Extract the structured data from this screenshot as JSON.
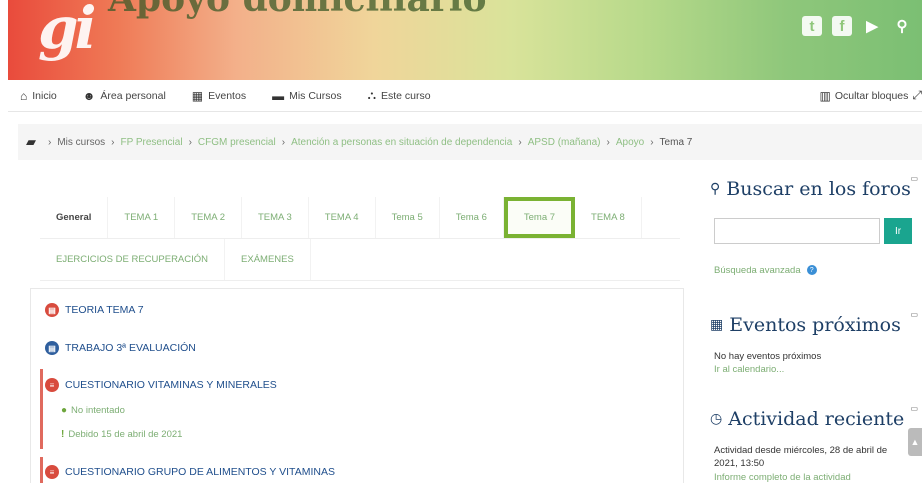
{
  "banner": {
    "logo": "gi",
    "title": "Apoyo domiciliario",
    "social": [
      {
        "icon": "twitter-icon",
        "glyph": "t"
      },
      {
        "icon": "facebook-icon",
        "glyph": "f"
      },
      {
        "icon": "youtube-icon",
        "glyph": "▶"
      },
      {
        "icon": "search-icon",
        "glyph": "⚲"
      }
    ]
  },
  "nav": {
    "items": [
      {
        "label": "Inicio",
        "icon": "home-icon",
        "glyph": "⌂"
      },
      {
        "label": "Área personal",
        "icon": "dashboard-icon",
        "glyph": "☻"
      },
      {
        "label": "Eventos",
        "icon": "calendar-icon",
        "glyph": "▦"
      },
      {
        "label": "Mis Cursos",
        "icon": "courses-icon",
        "glyph": "▬"
      },
      {
        "label": "Este curso",
        "icon": "sitemap-icon",
        "glyph": "⛬"
      }
    ],
    "hide_blocks": "Ocultar bloques"
  },
  "breadcrumb": [
    "Mis cursos",
    "FP Presencial",
    "CFGM presencial",
    "Atención a personas en situación de dependencia",
    "APSD (mañana)",
    "Apoyo",
    "Tema 7"
  ],
  "tabs": {
    "row1": [
      "General",
      "TEMA 1",
      "TEMA 2",
      "TEMA 3",
      "TEMA 4",
      "Tema 5",
      "Tema 6",
      "Tema 7",
      "TEMA 8"
    ],
    "row2": [
      "EJERCICIOS DE RECUPERACIÓN",
      "EXÁMENES"
    ],
    "active": "Tema 7"
  },
  "activities": [
    {
      "title": "TEORIA TEMA 7",
      "color": "#d84b3e"
    },
    {
      "title": "TRABAJO 3ª EVALUACIÓN",
      "color": "#2f5f9e"
    },
    {
      "title": "CUESTIONARIO VITAMINAS Y MINERALES",
      "color": "#d84b3e",
      "status": "No intentado",
      "due": "Debido 15 de abril de 2021"
    },
    {
      "title": "CUESTIONARIO GRUPO DE ALIMENTOS Y VITAMINAS",
      "color": "#d84b3e"
    }
  ],
  "sidebar": {
    "search": {
      "title": "Buscar en los foros",
      "button": "Ir",
      "advanced": "Búsqueda avanzada"
    },
    "events": {
      "title": "Eventos próximos",
      "empty": "No hay eventos próximos",
      "link": "Ir al calendario..."
    },
    "recent": {
      "title": "Actividad reciente",
      "since": "Actividad desde miércoles, 28 de abril de 2021, 13:50",
      "link": "Informe completo de la actividad"
    }
  }
}
